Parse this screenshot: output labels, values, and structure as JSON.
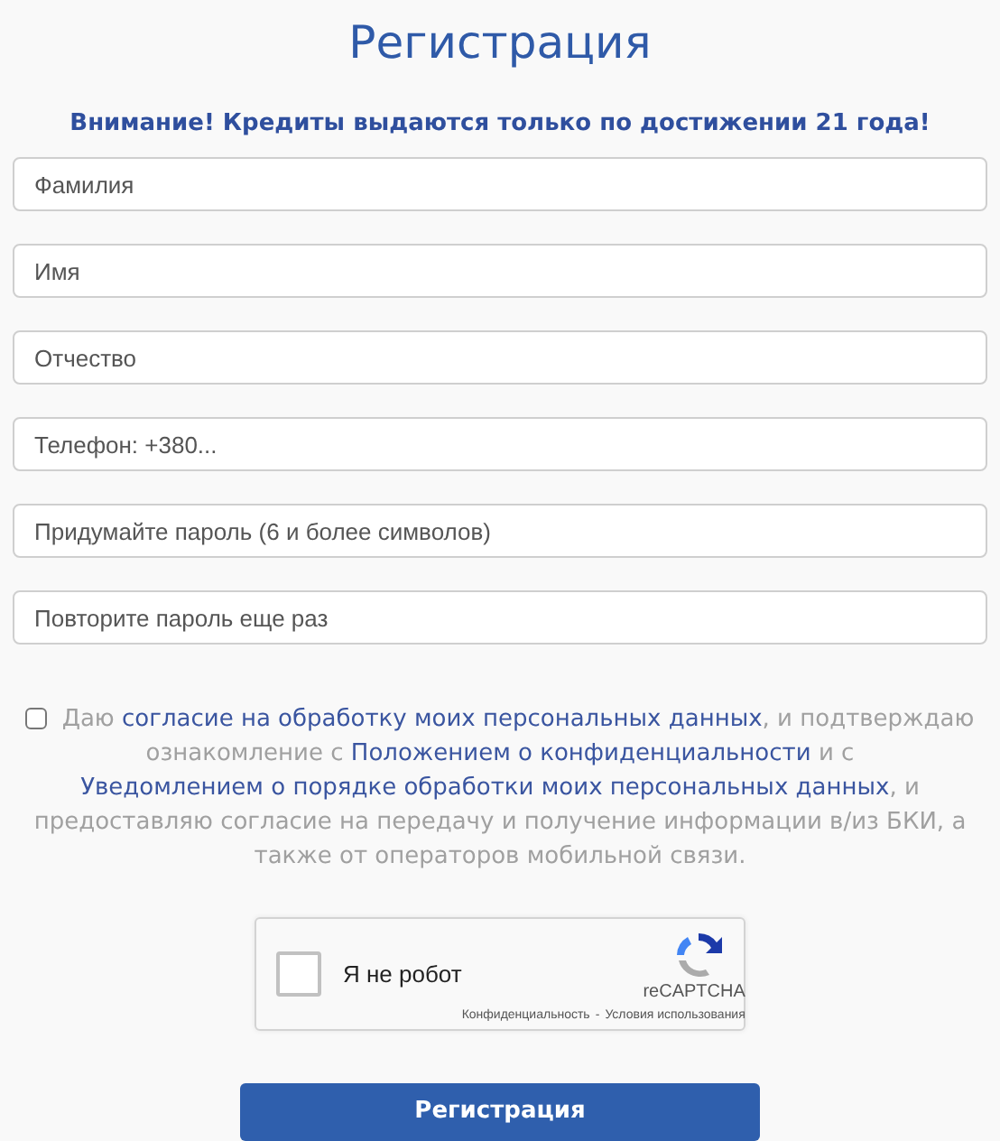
{
  "title": "Регистрация",
  "warning": "Внимание! Кредиты выдаются только по достижении 21 года!",
  "fields": [
    {
      "placeholder": "Фамилия"
    },
    {
      "placeholder": "Имя"
    },
    {
      "placeholder": "Отчество"
    },
    {
      "placeholder": "Телефон: +380..."
    },
    {
      "placeholder": "Придумайте пароль (6 и более символов)"
    },
    {
      "placeholder": "Повторите пароль еще раз"
    }
  ],
  "consent": {
    "checked": false,
    "parts": [
      {
        "kind": "text",
        "text": "Даю "
      },
      {
        "kind": "link",
        "text": "согласие на обработку моих персональных данных"
      },
      {
        "kind": "text",
        "text": ", и подтверждаю ознакомление с "
      },
      {
        "kind": "link",
        "text": "Положением о конфиденциальности"
      },
      {
        "kind": "text",
        "text": " и с "
      },
      {
        "kind": "link",
        "text": "Уведомлением о порядке обработки моих персональных данных"
      },
      {
        "kind": "text",
        "text": ", и предоставляю согласие на передачу и получение информации в/из БКИ, а также от операторов мобильной связи."
      }
    ]
  },
  "captcha": {
    "checked": false,
    "label": "Я не робот",
    "brand": "reCAPTCHA",
    "links": [
      "Конфиденциальность",
      "Условия использования"
    ],
    "separator": "-"
  },
  "submit": "Регистрация"
}
